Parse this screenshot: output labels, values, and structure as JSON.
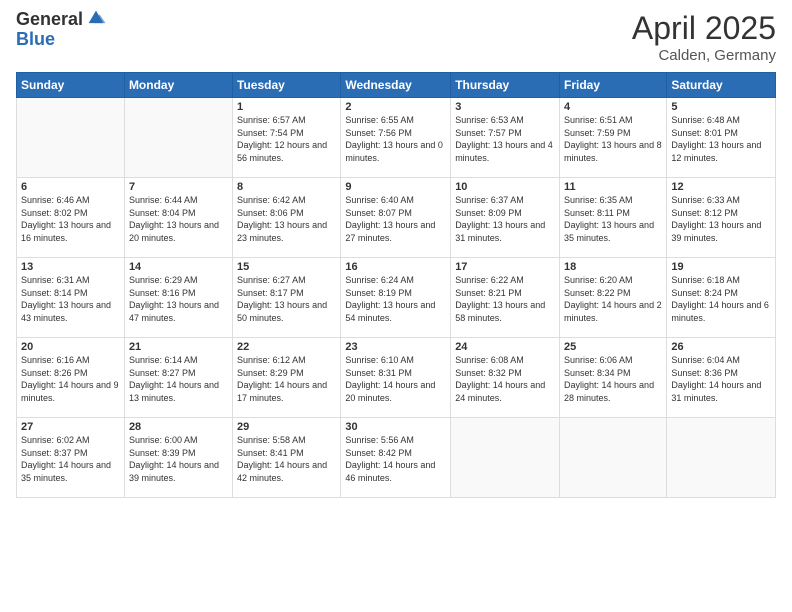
{
  "logo": {
    "general": "General",
    "blue": "Blue"
  },
  "title": "April 2025",
  "location": "Calden, Germany",
  "weekdays": [
    "Sunday",
    "Monday",
    "Tuesday",
    "Wednesday",
    "Thursday",
    "Friday",
    "Saturday"
  ],
  "weeks": [
    [
      {
        "day": "",
        "info": ""
      },
      {
        "day": "",
        "info": ""
      },
      {
        "day": "1",
        "info": "Sunrise: 6:57 AM\nSunset: 7:54 PM\nDaylight: 12 hours and 56 minutes."
      },
      {
        "day": "2",
        "info": "Sunrise: 6:55 AM\nSunset: 7:56 PM\nDaylight: 13 hours and 0 minutes."
      },
      {
        "day": "3",
        "info": "Sunrise: 6:53 AM\nSunset: 7:57 PM\nDaylight: 13 hours and 4 minutes."
      },
      {
        "day": "4",
        "info": "Sunrise: 6:51 AM\nSunset: 7:59 PM\nDaylight: 13 hours and 8 minutes."
      },
      {
        "day": "5",
        "info": "Sunrise: 6:48 AM\nSunset: 8:01 PM\nDaylight: 13 hours and 12 minutes."
      }
    ],
    [
      {
        "day": "6",
        "info": "Sunrise: 6:46 AM\nSunset: 8:02 PM\nDaylight: 13 hours and 16 minutes."
      },
      {
        "day": "7",
        "info": "Sunrise: 6:44 AM\nSunset: 8:04 PM\nDaylight: 13 hours and 20 minutes."
      },
      {
        "day": "8",
        "info": "Sunrise: 6:42 AM\nSunset: 8:06 PM\nDaylight: 13 hours and 23 minutes."
      },
      {
        "day": "9",
        "info": "Sunrise: 6:40 AM\nSunset: 8:07 PM\nDaylight: 13 hours and 27 minutes."
      },
      {
        "day": "10",
        "info": "Sunrise: 6:37 AM\nSunset: 8:09 PM\nDaylight: 13 hours and 31 minutes."
      },
      {
        "day": "11",
        "info": "Sunrise: 6:35 AM\nSunset: 8:11 PM\nDaylight: 13 hours and 35 minutes."
      },
      {
        "day": "12",
        "info": "Sunrise: 6:33 AM\nSunset: 8:12 PM\nDaylight: 13 hours and 39 minutes."
      }
    ],
    [
      {
        "day": "13",
        "info": "Sunrise: 6:31 AM\nSunset: 8:14 PM\nDaylight: 13 hours and 43 minutes."
      },
      {
        "day": "14",
        "info": "Sunrise: 6:29 AM\nSunset: 8:16 PM\nDaylight: 13 hours and 47 minutes."
      },
      {
        "day": "15",
        "info": "Sunrise: 6:27 AM\nSunset: 8:17 PM\nDaylight: 13 hours and 50 minutes."
      },
      {
        "day": "16",
        "info": "Sunrise: 6:24 AM\nSunset: 8:19 PM\nDaylight: 13 hours and 54 minutes."
      },
      {
        "day": "17",
        "info": "Sunrise: 6:22 AM\nSunset: 8:21 PM\nDaylight: 13 hours and 58 minutes."
      },
      {
        "day": "18",
        "info": "Sunrise: 6:20 AM\nSunset: 8:22 PM\nDaylight: 14 hours and 2 minutes."
      },
      {
        "day": "19",
        "info": "Sunrise: 6:18 AM\nSunset: 8:24 PM\nDaylight: 14 hours and 6 minutes."
      }
    ],
    [
      {
        "day": "20",
        "info": "Sunrise: 6:16 AM\nSunset: 8:26 PM\nDaylight: 14 hours and 9 minutes."
      },
      {
        "day": "21",
        "info": "Sunrise: 6:14 AM\nSunset: 8:27 PM\nDaylight: 14 hours and 13 minutes."
      },
      {
        "day": "22",
        "info": "Sunrise: 6:12 AM\nSunset: 8:29 PM\nDaylight: 14 hours and 17 minutes."
      },
      {
        "day": "23",
        "info": "Sunrise: 6:10 AM\nSunset: 8:31 PM\nDaylight: 14 hours and 20 minutes."
      },
      {
        "day": "24",
        "info": "Sunrise: 6:08 AM\nSunset: 8:32 PM\nDaylight: 14 hours and 24 minutes."
      },
      {
        "day": "25",
        "info": "Sunrise: 6:06 AM\nSunset: 8:34 PM\nDaylight: 14 hours and 28 minutes."
      },
      {
        "day": "26",
        "info": "Sunrise: 6:04 AM\nSunset: 8:36 PM\nDaylight: 14 hours and 31 minutes."
      }
    ],
    [
      {
        "day": "27",
        "info": "Sunrise: 6:02 AM\nSunset: 8:37 PM\nDaylight: 14 hours and 35 minutes."
      },
      {
        "day": "28",
        "info": "Sunrise: 6:00 AM\nSunset: 8:39 PM\nDaylight: 14 hours and 39 minutes."
      },
      {
        "day": "29",
        "info": "Sunrise: 5:58 AM\nSunset: 8:41 PM\nDaylight: 14 hours and 42 minutes."
      },
      {
        "day": "30",
        "info": "Sunrise: 5:56 AM\nSunset: 8:42 PM\nDaylight: 14 hours and 46 minutes."
      },
      {
        "day": "",
        "info": ""
      },
      {
        "day": "",
        "info": ""
      },
      {
        "day": "",
        "info": ""
      }
    ]
  ]
}
